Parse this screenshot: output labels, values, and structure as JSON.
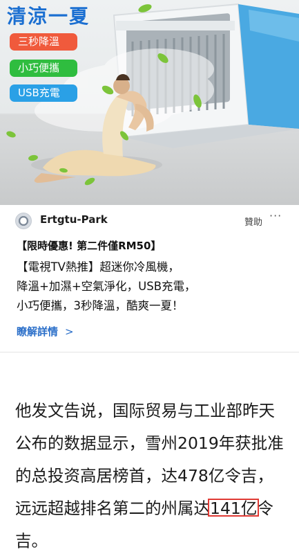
{
  "ad": {
    "hero": {
      "headline": "清涼一夏",
      "pills": [
        "三秒降溫",
        "小巧便攜",
        "USB充電"
      ]
    },
    "advertiser_name": "Ertgtu-Park",
    "sponsored_label": "贊助",
    "more_label": "···",
    "promo_title": "【限時優惠! 第二件僅RM50】",
    "promo_body_lines": [
      "【電視TV熱推】超迷你冷風機，",
      "降溫+加濕+空氣淨化，USB充電，",
      "小巧便攜，3秒降溫，酷爽一夏！"
    ],
    "learn_more_label": "瞭解詳情",
    "learn_more_chevron": ">"
  },
  "article": {
    "lines": [
      "他发文告说，国际贸易与工业部昨天",
      "公布的数据显示，雪州2019年获批准",
      "的总投资高居榜首，达478亿令吉，"
    ],
    "line4_before": "远远超越排名第二的州属达",
    "line4_highlight": "141亿",
    "line4_after": "令",
    "line5": "吉。",
    "highlight_color": "#e03a34"
  },
  "colors": {
    "headline": "#1b6fd1",
    "pill_red": "#f05a3c",
    "pill_green": "#2fbd3f",
    "pill_blue": "#2aa0e6",
    "link": "#2b6fc9"
  }
}
